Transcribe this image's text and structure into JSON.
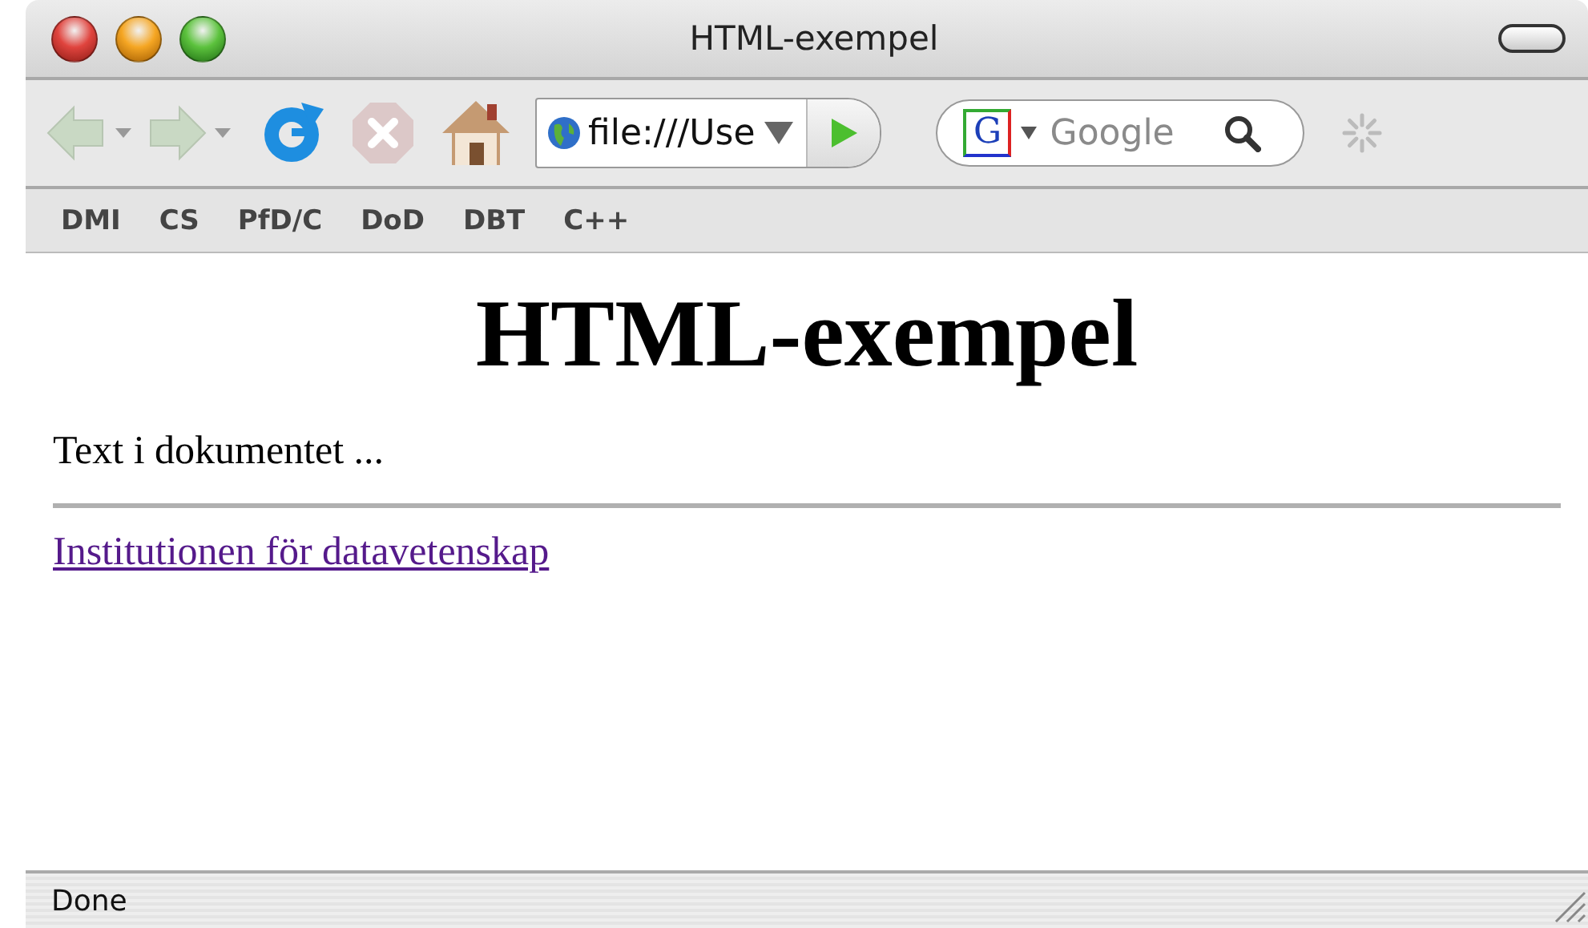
{
  "window": {
    "title": "HTML-exempel"
  },
  "toolbar": {
    "url": "file:///Use",
    "search_engine_letter": "G",
    "search_placeholder": "Google"
  },
  "bookmarks": [
    {
      "label": "DMI"
    },
    {
      "label": "CS"
    },
    {
      "label": "PfD/C"
    },
    {
      "label": "DoD"
    },
    {
      "label": "DBT"
    },
    {
      "label": "C++"
    }
  ],
  "page": {
    "heading": "HTML-exempel",
    "paragraph": "Text i dokumentet ...",
    "link": "Institutionen för datavetenskap"
  },
  "status_bar": {
    "text": "Done"
  }
}
